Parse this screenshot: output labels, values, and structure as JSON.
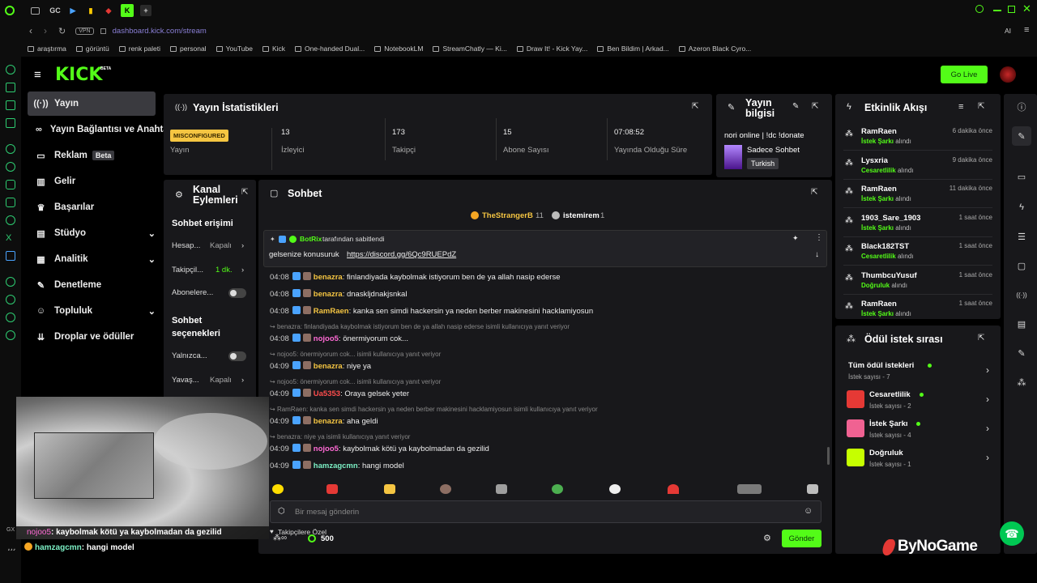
{
  "browser": {
    "tabs": [
      "GC"
    ],
    "url": "dashboard.kick.com/stream",
    "vpn": "VPN",
    "ai": "AI",
    "bookmarks": [
      "araştırma",
      "görüntü",
      "renk paleti",
      "personal",
      "YouTube",
      "Kick",
      "One-handed Dual...",
      "NotebookLM",
      "StreamChatly — Ki...",
      "Draw It! - Kick Yay...",
      "Ben Bildim | Arkad...",
      "Azeron Black Cyro..."
    ]
  },
  "header": {
    "logo": "KICK",
    "logo_beta": "BETA",
    "go_live": "Go Live"
  },
  "nav": [
    {
      "label": "Yayın"
    },
    {
      "label": "Yayın Bağlantısı ve Anahtarı"
    },
    {
      "label": "Reklam",
      "badge": "Beta"
    },
    {
      "label": "Gelir"
    },
    {
      "label": "Başarılar"
    },
    {
      "label": "Stüdyo"
    },
    {
      "label": "Analitik"
    },
    {
      "label": "Denetleme"
    },
    {
      "label": "Topluluk"
    },
    {
      "label": "Droplar ve ödüller"
    }
  ],
  "stats": {
    "title": "Yayın İstatistikleri",
    "status_badge": "MISCONFIGURED",
    "status_label": "Yayın",
    "cells": [
      {
        "value": "13",
        "label": "İzleyici"
      },
      {
        "value": "173",
        "label": "Takipçi"
      },
      {
        "value": "15",
        "label": "Abone Sayısı"
      },
      {
        "value": "07:08:52",
        "label": "Yayında Olduğu Süre"
      }
    ]
  },
  "stream_info": {
    "title_line1": "Yayın",
    "title_line2": "bilgisi",
    "stream_title": "nori online | !dc !donate",
    "category": "Sadece Sohbet",
    "language": "Turkish"
  },
  "activity": {
    "title": "Etkinlik Akışı",
    "items": [
      {
        "name": "RamRaen",
        "reward": "İstek Şarkı",
        "suffix": "alındı",
        "time": "6 dakika önce"
      },
      {
        "name": "Lysxria",
        "reward": "Cesaretlilik",
        "suffix": "alındı",
        "time": "9 dakika önce"
      },
      {
        "name": "RamRaen",
        "reward": "İstek Şarkı",
        "suffix": "alındı",
        "time": "11 dakika önce"
      },
      {
        "name": "1903_Sare_1903",
        "reward": "İstek Şarkı",
        "suffix": "alındı",
        "time": "1 saat önce"
      },
      {
        "name": "Black182TST",
        "reward": "Cesaretlilik",
        "suffix": "alındı",
        "time": "1 saat önce"
      },
      {
        "name": "ThumbcuYusuf",
        "reward": "Doğruluk",
        "suffix": "alındı",
        "time": "1 saat önce"
      },
      {
        "name": "RamRaen",
        "reward": "İstek Şarkı",
        "suffix": "alındı",
        "time": "1 saat önce"
      }
    ]
  },
  "rewards": {
    "title": "Ödül istek sırası",
    "all_title": "Tüm ödül istekleri",
    "all_sub": "İstek sayısı - 7",
    "items": [
      {
        "name": "Cesaretlilik",
        "sub": "İstek sayısı - 2",
        "color": "#e53935"
      },
      {
        "name": "İstek Şarkı",
        "sub": "İstek sayısı - 4",
        "color": "#f06292"
      },
      {
        "name": "Doğruluk",
        "sub": "İstek sayısı - 1",
        "color": "#c6ff00"
      }
    ]
  },
  "channel": {
    "title_line1": "Kanal",
    "title_line2": "Eylemleri",
    "chat_access": "Sohbet erişimi",
    "rows": [
      {
        "label": "Hesap...",
        "value": "Kapalı"
      },
      {
        "label": "Takipçil...",
        "value": "1 dk."
      },
      {
        "label": "Abonelere..."
      }
    ],
    "options_line1": "Sohbet",
    "options_line2": "seçenekleri",
    "rows2": [
      {
        "label": "Yalnızca..."
      },
      {
        "label": "Yavaş...",
        "value": "Kapalı"
      }
    ]
  },
  "chat": {
    "title": "Sohbet",
    "top_users": [
      {
        "name": "TheStrangerB",
        "count": "11"
      },
      {
        "name": "istemirem",
        "count": "1"
      }
    ],
    "pinned_by": "BotRix",
    "pinned_by_suffix": "tarafından sabitlendi",
    "pinned_text": "gelsenize konusuruk",
    "pinned_link": "https://discord.gg/6Qc9RUEPdZ",
    "messages": [
      {
        "time": "04:08",
        "user": "benazra",
        "text": "finlandiyada kaybolmak istiyorum ben de ya allah nasip ederse",
        "color": "#f5c542"
      },
      {
        "time": "04:08",
        "user": "benazra",
        "text": "dnaskljdnakjsnkal",
        "color": "#f5c542"
      },
      {
        "time": "04:08",
        "user": "RamRaen",
        "text": "kanka sen simdi hackersin ya neden berber makinesini hacklamiyosun",
        "color": "#f5c542"
      },
      {
        "reply": "benazra: finlandiyada kaybolmak istiyorum ben de ya allah nasip ederse isimli kullanıcıya yanıt veriyor",
        "time": "04:08",
        "user": "nojoo5",
        "text": "önermiyorum cok...",
        "color": "#ff6ad5"
      },
      {
        "reply": "nojoo5: önermiyorum cok... isimli kullanıcıya yanıt veriyor",
        "time": "04:09",
        "user": "benazra",
        "text": "niye ya",
        "color": "#f5c542"
      },
      {
        "reply": "nojoo5: önermiyorum cok... isimli kullanıcıya yanıt veriyor",
        "time": "04:09",
        "user": "Ua5353",
        "text": "Oraya gelsek yeter",
        "color": "#ff4d4d"
      },
      {
        "reply": "RamRaen: kanka sen simdi hackersin ya neden berber makinesini hacklamiyosun isimli kullanıcıya yanıt veriyor",
        "time": "04:09",
        "user": "benazra",
        "text": "aha geldi",
        "color": "#f5c542"
      },
      {
        "reply": "benazra: niye ya isimli kullanıcıya yanıt veriyor",
        "time": "04:09",
        "user": "nojoo5",
        "text": "kaybolmak kötü ya kaybolmadan da gezilid",
        "color": "#ff6ad5"
      },
      {
        "time": "04:09",
        "user": "hamzagcmn",
        "text": "hangi model",
        "color": "#7cf0c5"
      }
    ],
    "follower_only": "Takipçilere Özel",
    "input_placeholder": "Bir mesaj gönderin",
    "points": "500",
    "send": "Gönder"
  },
  "overlay": {
    "lines": [
      {
        "user": "nojoo5",
        "text": ": kaybolmak kötü ya kaybolmadan da gezilid"
      },
      {
        "user": "hamzagcmn",
        "text": ": hangi model"
      }
    ]
  },
  "watermark": "ByNoGame",
  "colors": {
    "accent": "#53fc18",
    "panel": "#18181b",
    "bg": "#000000"
  }
}
